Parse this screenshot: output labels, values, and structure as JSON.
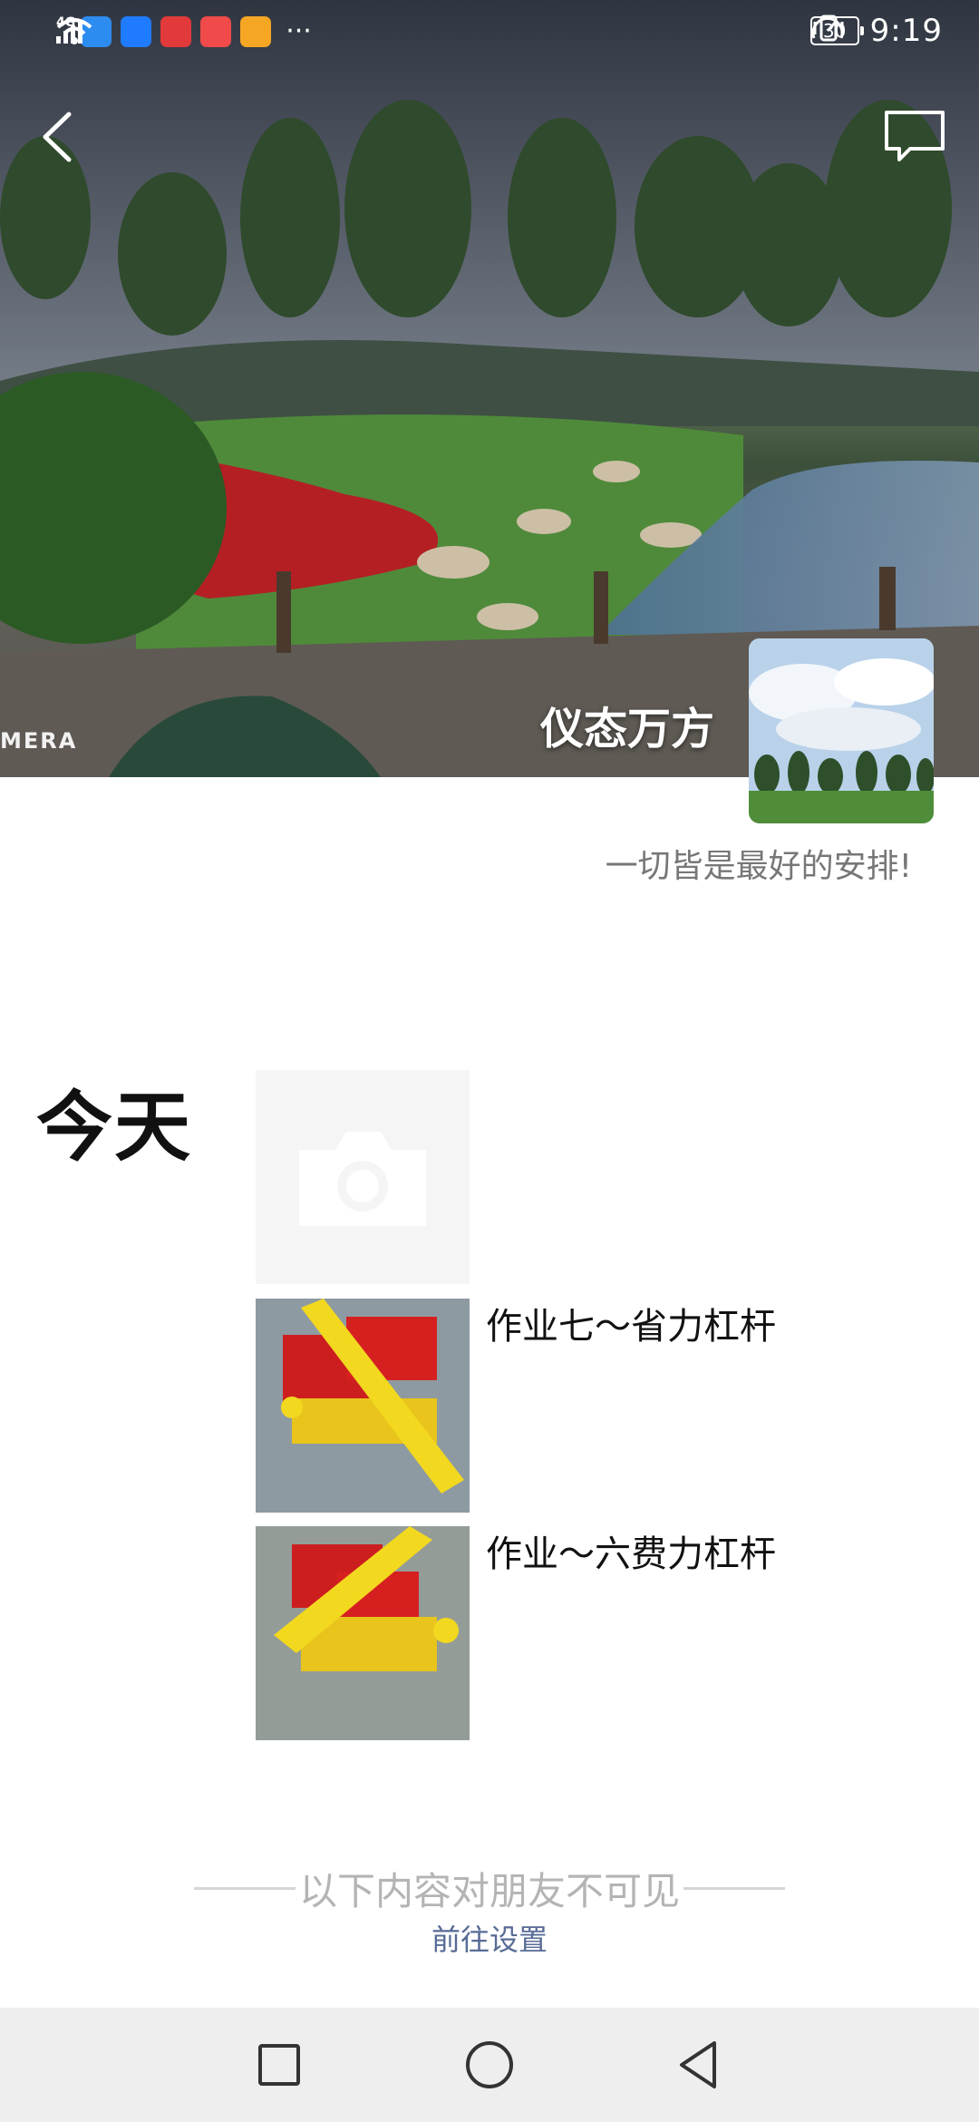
{
  "status_bar": {
    "network": "4G",
    "more_indicator": "···",
    "battery": "30",
    "time": "9:19",
    "notification_icons": [
      {
        "name": "feather-app-icon",
        "color": "#2d8cf0"
      },
      {
        "name": "lark-app-icon",
        "color": "#1f7bff"
      },
      {
        "name": "du-app-icon",
        "color": "#e23a3a"
      },
      {
        "name": "smile-app-icon",
        "color": "#f04a4a"
      },
      {
        "name": "tips-app-icon",
        "color": "#f5a623"
      }
    ]
  },
  "header": {
    "back_icon": "chevron-left-icon",
    "comment_icon": "message-icon"
  },
  "cover": {
    "camera_watermark": "MERA"
  },
  "profile": {
    "nickname": "仪态万方",
    "signature": "一切皆是最好的安排!"
  },
  "timeline": {
    "day_label": "今天",
    "camera_placeholder_icon": "camera-icon",
    "posts": [
      {
        "caption": "作业七～省力杠杆",
        "thumb_icon": "lego-lever-photo"
      },
      {
        "caption": "作业～六费力杠杆",
        "thumb_icon": "lego-lever-photo"
      }
    ]
  },
  "privacy": {
    "notice": "以下内容对朋友不可见",
    "link": "前往设置"
  },
  "nav": {
    "recents_icon": "square-icon",
    "home_icon": "circle-icon",
    "back_icon": "triangle-back-icon"
  },
  "colors": {
    "link": "#576b95",
    "muted_text": "#777777",
    "notice_text": "#b4b4b4",
    "nav_bg": "#eeeeee"
  }
}
